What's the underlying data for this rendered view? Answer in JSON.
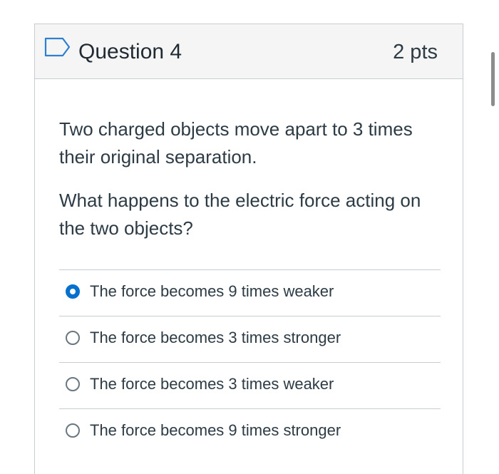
{
  "question": {
    "title": "Question 4",
    "points": "2 pts",
    "paragraphs": [
      "Two charged objects move apart to 3 times their original separation.",
      "What happens to the electric force acting on the two objects?"
    ],
    "answers": [
      {
        "label": "The force becomes 9 times weaker",
        "selected": true
      },
      {
        "label": "The force becomes 3 times stronger",
        "selected": false
      },
      {
        "label": "The force becomes 3 times weaker",
        "selected": false
      },
      {
        "label": "The force becomes 9 times stronger",
        "selected": false
      }
    ]
  },
  "colors": {
    "accent": "#0770cf",
    "header_bg": "#f5f5f5",
    "border": "#c7cdd1",
    "text": "#2d3b45"
  },
  "icons": {
    "flag": "bookmark-flag-icon"
  }
}
